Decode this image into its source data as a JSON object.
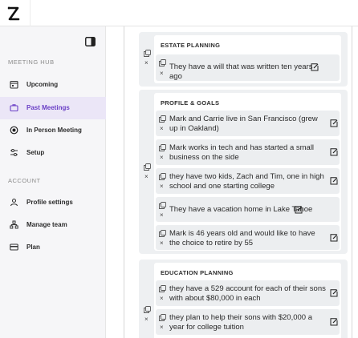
{
  "sidebar": {
    "meeting_hub_label": "MEETING HUB",
    "account_label": "ACCOUNT",
    "items": [
      {
        "label": "Upcoming",
        "icon": "calendar-icon"
      },
      {
        "label": "Past Meetings",
        "icon": "briefcase-icon",
        "active": true
      },
      {
        "label": "In Person Meeting",
        "icon": "record-icon"
      },
      {
        "label": "Setup",
        "icon": "sliders-icon"
      },
      {
        "label": "Profile settings",
        "icon": "user-icon"
      },
      {
        "label": "Manage team",
        "icon": "team-icon"
      },
      {
        "label": "Plan",
        "icon": "card-icon"
      }
    ]
  },
  "colors": {
    "accent": "#6a3fc6",
    "active_bg": "#ebe6f7"
  },
  "sections": [
    {
      "title": "ESTATE PLANNING",
      "items": [
        {
          "text": "They have a will that was written ten years ago"
        }
      ]
    },
    {
      "title": "PROFILE & GOALS",
      "items": [
        {
          "text": "Mark and Carrie live in San Francisco (grew up in Oakland)"
        },
        {
          "text": "Mark works in tech and has started a small business on the side"
        },
        {
          "text": "they have two kids, Zach and Tim, one in high school and one starting college"
        },
        {
          "text": "They have a vacation home in Lake Tahoe"
        },
        {
          "text": "Mark is 46 years old and would like to have the choice to retire by 55"
        }
      ]
    },
    {
      "title": "EDUCATION PLANNING",
      "items": [
        {
          "text": "they have a 529 account for each of their sons with about $80,000 in each"
        },
        {
          "text": "they plan to help their sons with $20,000 a year for college tuition"
        }
      ]
    }
  ]
}
